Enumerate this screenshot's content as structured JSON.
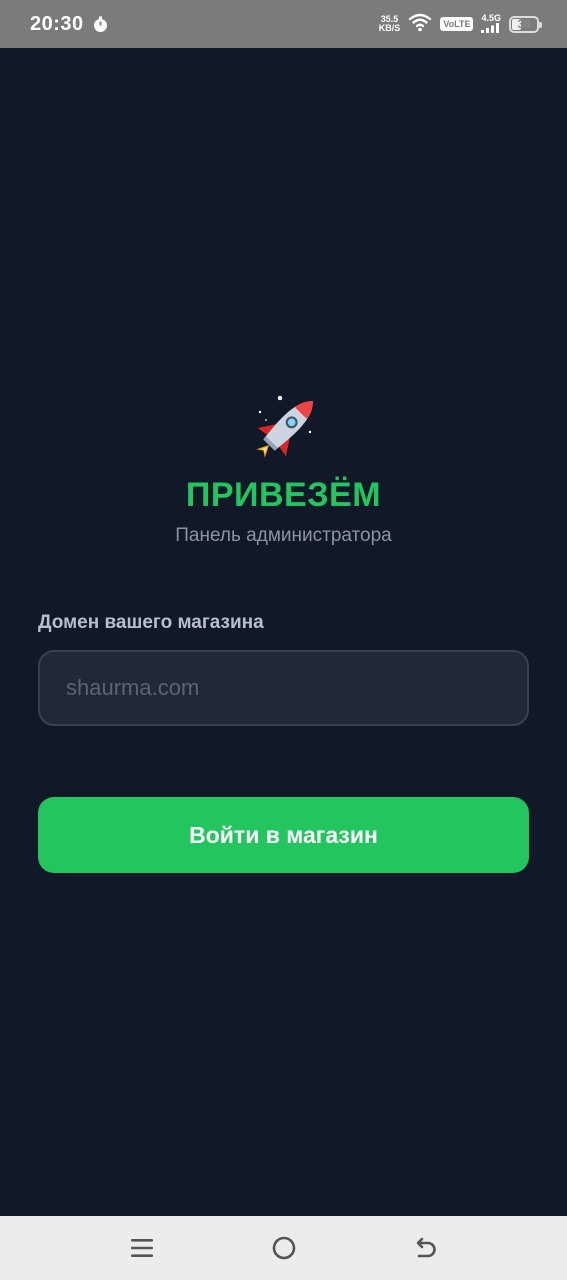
{
  "status_bar": {
    "time": "20:30",
    "speed_value": "35.5",
    "speed_unit": "KB/S",
    "volte": "VoLTE",
    "network": "4.5G",
    "battery_level": "38",
    "icons": [
      "stopwatch-icon",
      "wifi-icon",
      "signal-icon",
      "battery-icon"
    ]
  },
  "brand": {
    "logo_icon": "rocket-icon",
    "title": "ПРИВЕЗЁМ",
    "subtitle": "Панель администратора"
  },
  "form": {
    "domain_label": "Домен вашего магазина",
    "domain_placeholder": "shaurma.com",
    "domain_value": "",
    "login_button": "Войти в магазин"
  },
  "nav_bar": {
    "icons": [
      "menu-icon",
      "home-icon",
      "back-icon"
    ]
  },
  "colors": {
    "background": "#111827",
    "accent": "#22c55e",
    "input_background": "#1f2937",
    "status_bar": "#7b7b7b",
    "nav_bar": "#ececec"
  }
}
